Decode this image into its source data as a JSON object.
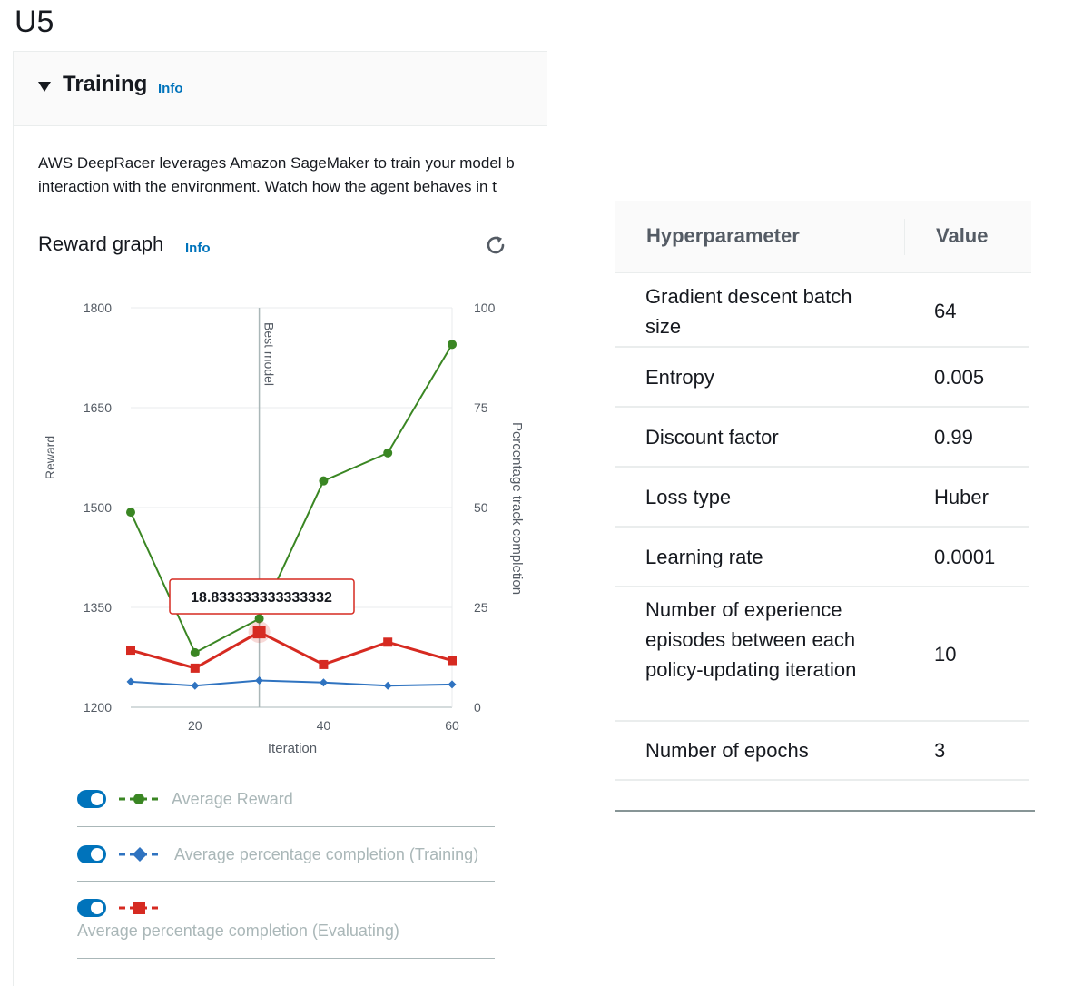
{
  "page": {
    "heading": "U5",
    "training_title": "Training",
    "info_label": "Info",
    "description_line1": "AWS DeepRacer leverages Amazon SageMaker to train your model b",
    "description_line2": "interaction with the environment. Watch how the agent behaves in t",
    "reward_graph_title": "Reward graph"
  },
  "colors": {
    "reward": "#3a8623",
    "training": "#2f73c0",
    "evaluating": "#d62a21",
    "link": "#0073bb"
  },
  "chart_data": {
    "type": "line",
    "xlabel": "Iteration",
    "ylabel": "Reward",
    "y2label": "Percentage track completion",
    "x_ticks": [
      20,
      40,
      60
    ],
    "y_ticks": [
      1200,
      1350,
      1500,
      1650,
      1800
    ],
    "y2_ticks": [
      0,
      25,
      50,
      75,
      100
    ],
    "xlim": [
      10,
      60
    ],
    "ylim": [
      1200,
      1800
    ],
    "y2lim": [
      0,
      100
    ],
    "best_model_label": "Best model",
    "best_model_x": 30,
    "tooltip_text": "18.833333333333332",
    "tooltip_x": 30,
    "series": [
      {
        "name": "Average Reward",
        "axis": "left",
        "marker": "circle",
        "color": "#3a8623",
        "x": [
          10,
          20,
          30,
          40,
          50,
          60
        ],
        "values": [
          1493,
          1282,
          1333,
          1540,
          1582,
          1745
        ]
      },
      {
        "name": "Average percentage completion (Training)",
        "axis": "right",
        "marker": "diamond",
        "color": "#2f73c0",
        "x": [
          10,
          20,
          30,
          40,
          50,
          60
        ],
        "values": [
          6.4,
          5.4,
          6.7,
          6.2,
          5.4,
          5.7
        ]
      },
      {
        "name": "Average percentage completion (Evaluating)",
        "axis": "right",
        "marker": "square",
        "color": "#d62a21",
        "x": [
          10,
          20,
          30,
          40,
          50,
          60
        ],
        "values": [
          14.3,
          9.8,
          18.833333333333332,
          10.7,
          16.3,
          11.7
        ]
      }
    ]
  },
  "table": {
    "header_name": "Hyperparameter",
    "header_value": "Value",
    "rows": [
      {
        "name": "Gradient descent batch size",
        "value": "64"
      },
      {
        "name": "Entropy",
        "value": "0.005"
      },
      {
        "name": "Discount factor",
        "value": "0.99"
      },
      {
        "name": "Loss type",
        "value": "Huber"
      },
      {
        "name": "Learning rate",
        "value": "0.0001"
      },
      {
        "name": "Number of experience episodes between each policy-updating iteration",
        "value": "10"
      },
      {
        "name": "Number of epochs",
        "value": "3"
      }
    ]
  }
}
